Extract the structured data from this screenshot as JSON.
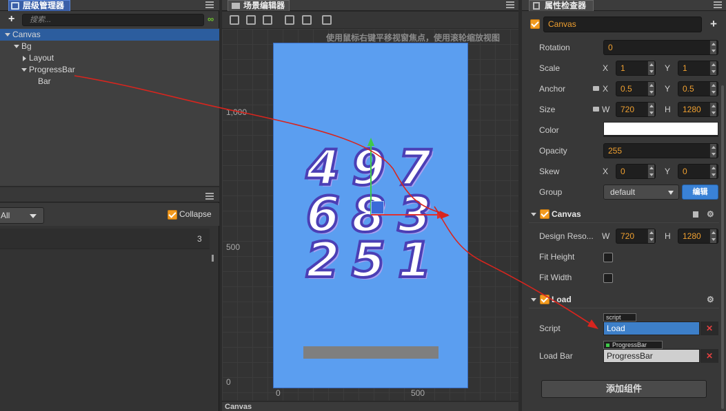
{
  "hierarchy": {
    "title": "层级管理器",
    "search_placeholder": "搜索...",
    "nodes": [
      {
        "label": "Canvas"
      },
      {
        "label": "Bg"
      },
      {
        "label": "Layout"
      },
      {
        "label": "ProgressBar"
      },
      {
        "label": "Bar"
      }
    ]
  },
  "console": {
    "filter": "All",
    "collapse_label": "Collapse",
    "count": "3"
  },
  "scene": {
    "title": "场景编辑器",
    "hint": "使用鼠标右键平移视窗焦点，使用滚轮缩放视图",
    "ruler_y": [
      "1,000",
      "500",
      "0"
    ],
    "ruler_x": [
      "0",
      "500"
    ],
    "footer": "Canvas",
    "digits": [
      "4",
      "9",
      "7",
      "6",
      "8",
      "3",
      "2",
      "5",
      "1"
    ]
  },
  "inspector": {
    "title": "属性检查器",
    "node_name": "Canvas",
    "rotation_label": "Rotation",
    "rotation": "0",
    "scale_label": "Scale",
    "scale_x": "1",
    "scale_y": "1",
    "anchor_label": "Anchor",
    "anchor_x": "0.5",
    "anchor_y": "0.5",
    "size_label": "Size",
    "size_w": "720",
    "size_h": "1280",
    "color_label": "Color",
    "color_value": "#ffffff",
    "opacity_label": "Opacity",
    "opacity": "255",
    "skew_label": "Skew",
    "skew_x": "0",
    "skew_y": "0",
    "group_label": "Group",
    "group_value": "default",
    "edit_button": "编辑",
    "x": "X",
    "y": "Y",
    "w": "W",
    "h": "H",
    "canvas_section": "Canvas",
    "design_label": "Design Reso...",
    "design_w": "720",
    "design_h": "1280",
    "fit_height": "Fit Height",
    "fit_width": "Fit Width",
    "load_section": "Load",
    "script_label": "Script",
    "script_tag": "script",
    "script_value": "Load",
    "loadbar_label": "Load Bar",
    "loadbar_tag": "ProgressBar",
    "loadbar_value": "ProgressBar",
    "add_component": "添加组件"
  }
}
